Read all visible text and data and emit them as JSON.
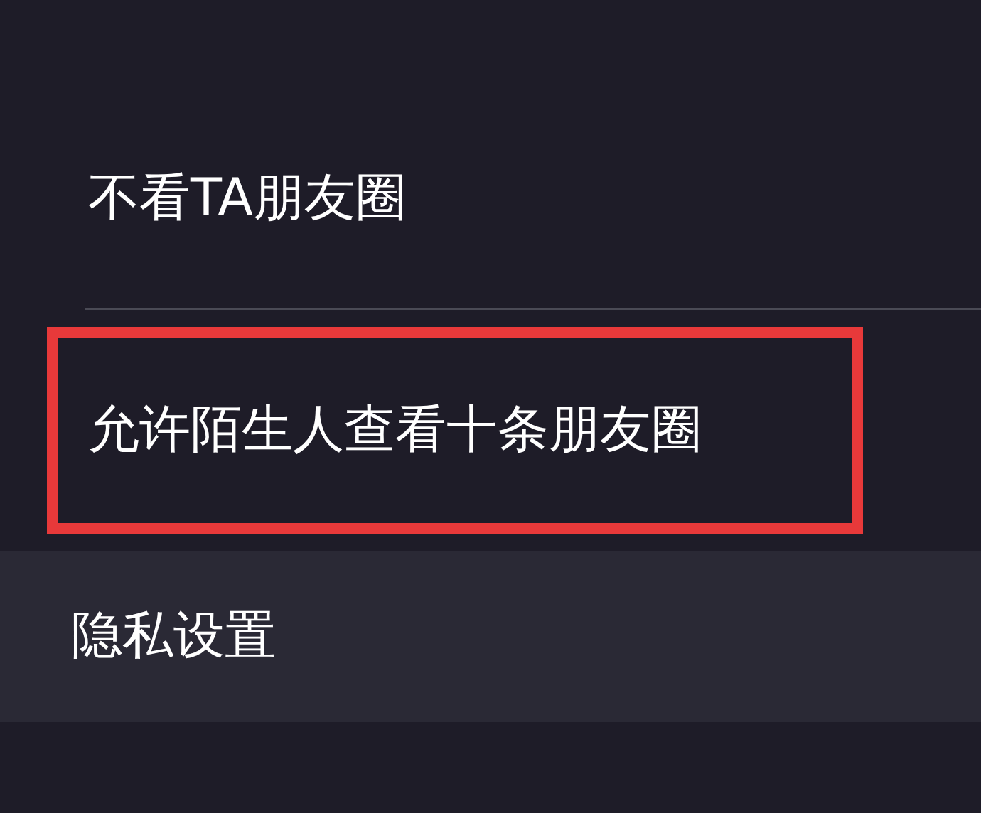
{
  "items": [
    {
      "label": "不看TA朋友圈",
      "highlighted": false
    },
    {
      "label": "允许陌生人查看十条朋友圈",
      "highlighted": true
    }
  ],
  "section_header": {
    "title": "隐私设置"
  }
}
